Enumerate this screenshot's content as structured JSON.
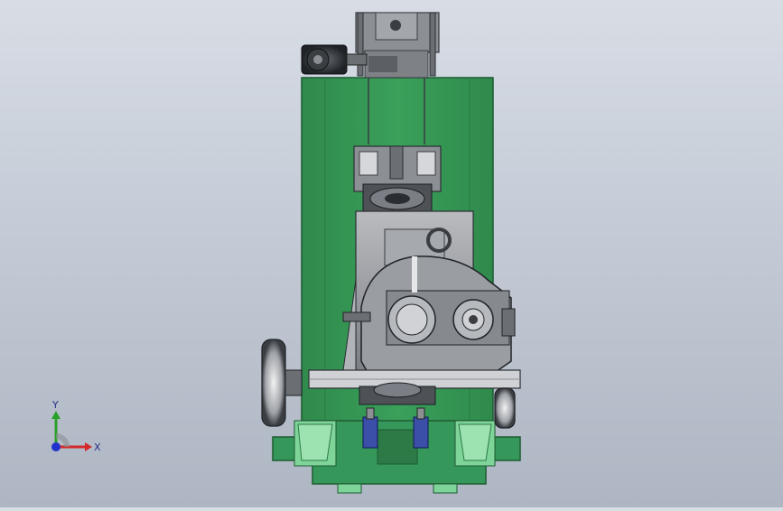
{
  "colors": {
    "background_top": "#d8dde5",
    "background_bottom": "#aeb6c3",
    "frame_green": "#3aa05a",
    "frame_green_dark": "#2d7a46",
    "frame_green_light": "#7fd49a",
    "steel_gray": "#8c8f94",
    "steel_light": "#c8c9cc",
    "steel_dark": "#4e5156",
    "motor_dark": "#2f3238",
    "valve_blue": "#3b4fa8",
    "axis_y": "#2aa02a",
    "axis_x": "#d22a2a",
    "axis_z": "#2233cc"
  },
  "viewport": {
    "triad": {
      "y_label": "Y",
      "x_label": "X"
    }
  }
}
